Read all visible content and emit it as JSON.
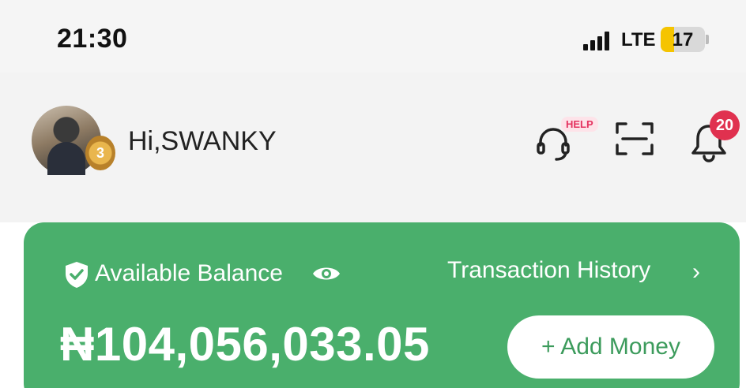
{
  "status_bar": {
    "time": "21:30",
    "network": "LTE",
    "battery": "17",
    "battery_level_percent": 17,
    "icons": [
      "signal-icon",
      "battery-icon"
    ]
  },
  "header": {
    "greeting": "Hi,SWANKY",
    "avatar_badge": "3",
    "help_label": "HELP",
    "notification_count": "20",
    "icons": [
      "avatar",
      "help-headset-icon",
      "scan-icon",
      "bell-icon"
    ]
  },
  "balance_card": {
    "label": "Available Balance",
    "transaction_history": "Transaction History",
    "chevron": "›",
    "amount": "₦104,056,033.05",
    "add_money": "+ Add Money",
    "icons": [
      "shield-check-icon",
      "eye-icon",
      "chevron-right-icon"
    ]
  },
  "colors": {
    "card_green": "#4aaf6c",
    "add_money_text": "#3c9b5c",
    "notification_red": "#e0314f",
    "battery_yellow": "#f5c400"
  }
}
